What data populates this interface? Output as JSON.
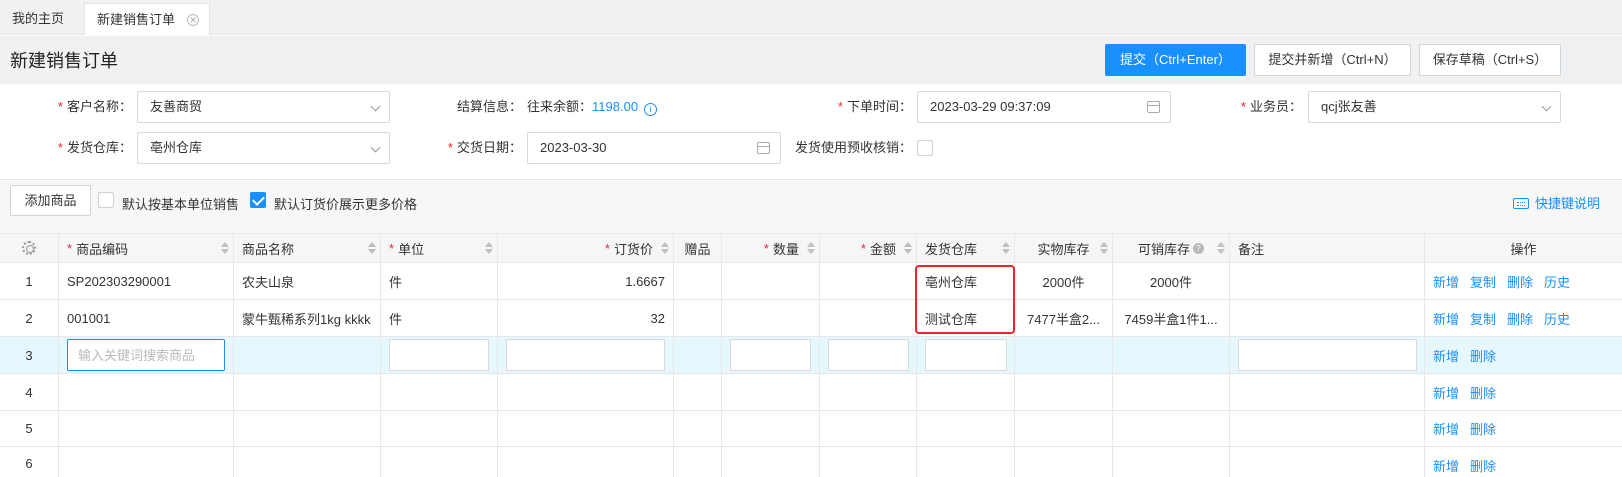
{
  "tabs": [
    {
      "label": "我的主页"
    },
    {
      "label": "新建销售订单"
    }
  ],
  "page": {
    "title": "新建销售订单",
    "submit_label": "提交（Ctrl+Enter）",
    "submit_new_label": "提交并新增（Ctrl+N）",
    "save_draft_label": "保存草稿（Ctrl+S）"
  },
  "form": {
    "customer": {
      "label": "客户名称：",
      "value": "友善商贸"
    },
    "settlement": {
      "label": "结算信息：",
      "prefix": "往来余额：",
      "balance": "1198.00"
    },
    "order_time": {
      "label": "下单时间：",
      "value": "2023-03-29 09:37:09"
    },
    "salesperson": {
      "label": "业务员：",
      "value": "qcj张友善"
    },
    "warehouse": {
      "label": "发货仓库：",
      "value": "亳州仓库"
    },
    "delivery_date": {
      "label": "交货日期：",
      "value": "2023-03-30"
    },
    "prepay": {
      "label": "发货使用预收核销："
    }
  },
  "toolbar": {
    "add_label": "添加商品",
    "basic_unit_label": "默认按基本单位销售",
    "more_price_label": "默认订货价展示更多价格",
    "shortcut_label": "快捷键说明"
  },
  "table": {
    "headers": {
      "code": "商品编码",
      "name": "商品名称",
      "unit": "单位",
      "price": "订货价",
      "gift": "赠品",
      "qty": "数量",
      "amount": "金额",
      "warehouse": "发货仓库",
      "stock": "实物库存",
      "sellable": "可销库存",
      "remark": "备注",
      "ops": "操作"
    },
    "rows": [
      {
        "no": "1",
        "code": "SP202303290001",
        "name": "农夫山泉",
        "unit": "件",
        "price": "1.6667",
        "warehouse": "亳州仓库",
        "stock": "2000件",
        "sellable": "2000件"
      },
      {
        "no": "2",
        "code": "001001",
        "name": "蒙牛甄稀系列1kg kkkk",
        "unit": "件",
        "price": "32",
        "warehouse": "测试仓库",
        "stock": "7477半盒2...",
        "sellable": "7459半盒1件1..."
      }
    ],
    "edit_row": {
      "no": "3",
      "search_placeholder": "输入关键词搜索商品"
    },
    "empty_rows": [
      {
        "no": "4"
      },
      {
        "no": "5"
      },
      {
        "no": "6"
      }
    ],
    "ops": {
      "add": "新增",
      "copy": "复制",
      "delete": "删除",
      "history": "历史"
    }
  }
}
